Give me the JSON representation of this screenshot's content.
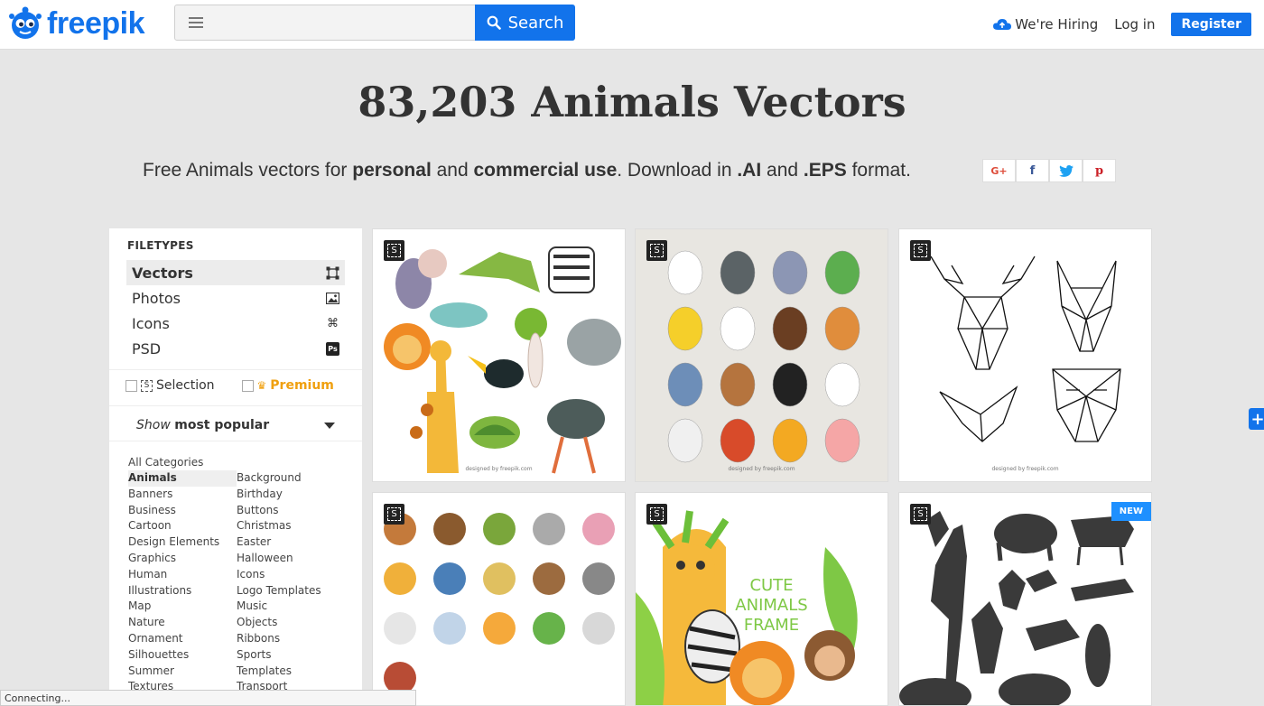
{
  "header": {
    "logo_text": "freepik",
    "search_placeholder": "",
    "search_button": "Search",
    "hiring": "We're Hiring",
    "login": "Log in",
    "register": "Register"
  },
  "hero": {
    "title": "83,203 Animals Vectors",
    "sub_1": "Free Animals vectors for ",
    "sub_2": "personal",
    "sub_3": " and ",
    "sub_4": "commercial use",
    "sub_5": ". Download in ",
    "sub_6": ".AI",
    "sub_7": " and ",
    "sub_8": ".EPS",
    "sub_9": " format.",
    "share": [
      "G+",
      "f",
      "t",
      "p"
    ]
  },
  "sidebar": {
    "filetypes_heading": "FILETYPES",
    "filetypes": [
      {
        "label": "Vectors",
        "icon": "vector-icon"
      },
      {
        "label": "Photos",
        "icon": "photo-icon"
      },
      {
        "label": "Icons",
        "icon": "command-icon"
      },
      {
        "label": "PSD",
        "icon": "ps-icon"
      }
    ],
    "selection": "Selection",
    "premium": "Premium",
    "sort_show": "Show",
    "sort_value": "most popular",
    "all_categories": "All Categories",
    "categories": [
      "Animals",
      "Background",
      "Banners",
      "Birthday",
      "Business",
      "Buttons",
      "Cartoon",
      "Christmas",
      "Design Elements",
      "Easter",
      "Graphics",
      "Halloween",
      "Human",
      "Icons",
      "Illustrations",
      "Logo Templates",
      "Map",
      "Music",
      "Nature",
      "Objects",
      "Ornament",
      "Ribbons",
      "Silhouettes",
      "Sports",
      "Summer",
      "Templates",
      "Textures",
      "Transport"
    ]
  },
  "cards": {
    "credit": "designed by freepik.com",
    "badge": "S",
    "new_badge": "NEW",
    "frame_title_1": "CUTE ANIMALS",
    "frame_title_2": "FRAME"
  },
  "status_bar": "Connecting..."
}
